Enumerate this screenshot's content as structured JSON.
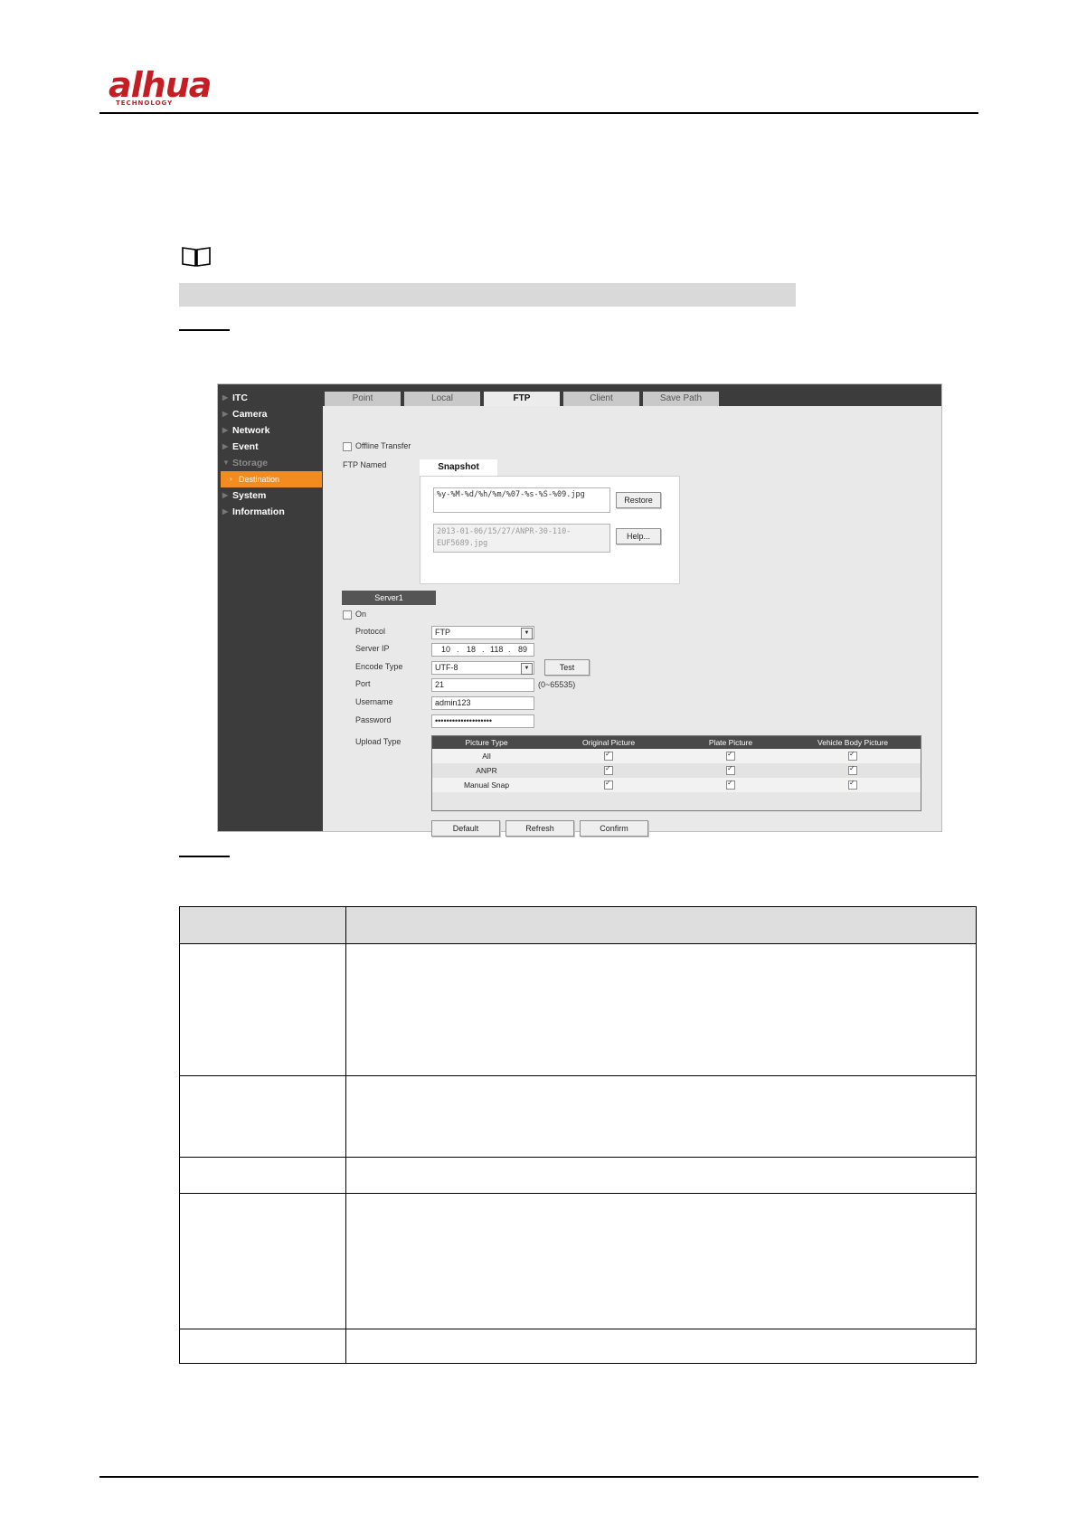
{
  "header": {
    "logo_text": "alhua",
    "logo_subtext": "TECHNOLOGY"
  },
  "colors": {
    "brand_red": "#c41e24",
    "nav_background": "#3c3c3c",
    "nav_active": "#f28c1e",
    "note_bar": "#d9d9d9",
    "table_header": "#dedede"
  },
  "note": {
    "icon": "book-icon"
  },
  "screenshot": {
    "nav": {
      "items": [
        {
          "label": "ITC",
          "state": "normal"
        },
        {
          "label": "Camera",
          "state": "normal"
        },
        {
          "label": "Network",
          "state": "normal"
        },
        {
          "label": "Event",
          "state": "normal"
        },
        {
          "label": "Storage",
          "state": "expanded"
        },
        {
          "label": "Destination",
          "state": "active"
        },
        {
          "label": "System",
          "state": "normal"
        },
        {
          "label": "Information",
          "state": "normal"
        }
      ]
    },
    "tabs": [
      {
        "label": "Point",
        "active": false
      },
      {
        "label": "Local",
        "active": false
      },
      {
        "label": "FTP",
        "active": true
      },
      {
        "label": "Client",
        "active": false
      },
      {
        "label": "Save Path",
        "active": false
      }
    ],
    "offline_transfer_label": "Offline Transfer",
    "offline_transfer_checked": false,
    "ftp_named_label": "FTP Named",
    "snapshot_tab": "Snapshot",
    "filename_pattern": "%y-%M-%d/%h/%m/%07-%s-%S-%09.jpg",
    "filename_preview": "2013-01-06/15/27/ANPR-30-110-EUF5689.jpg",
    "restore_button": "Restore",
    "help_button": "Help...",
    "server_tab": "Server1",
    "on_label": "On",
    "on_checked": false,
    "protocol": {
      "label": "Protocol",
      "value": "FTP"
    },
    "server_ip": {
      "label": "Server IP",
      "octets": [
        "10",
        "18",
        "118",
        "89"
      ]
    },
    "encode_type": {
      "label": "Encode Type",
      "value": "UTF-8"
    },
    "test_button": "Test",
    "port": {
      "label": "Port",
      "value": "21",
      "range": "(0~65535)"
    },
    "username": {
      "label": "Username",
      "value": "admin123"
    },
    "password": {
      "label": "Password",
      "value": "••••••••••••••••••••"
    },
    "upload_type": {
      "label": "Upload Type",
      "columns": [
        "Picture Type",
        "Original Picture",
        "Plate Picture",
        "Vehicle Body Picture"
      ],
      "rows": [
        {
          "type": "All",
          "checks": [
            true,
            true,
            true
          ]
        },
        {
          "type": "ANPR",
          "checks": [
            true,
            true,
            true
          ]
        },
        {
          "type": "Manual Snap",
          "checks": [
            true,
            true,
            true
          ]
        }
      ]
    },
    "buttons": {
      "default": "Default",
      "refresh": "Refresh",
      "confirm": "Confirm"
    }
  }
}
